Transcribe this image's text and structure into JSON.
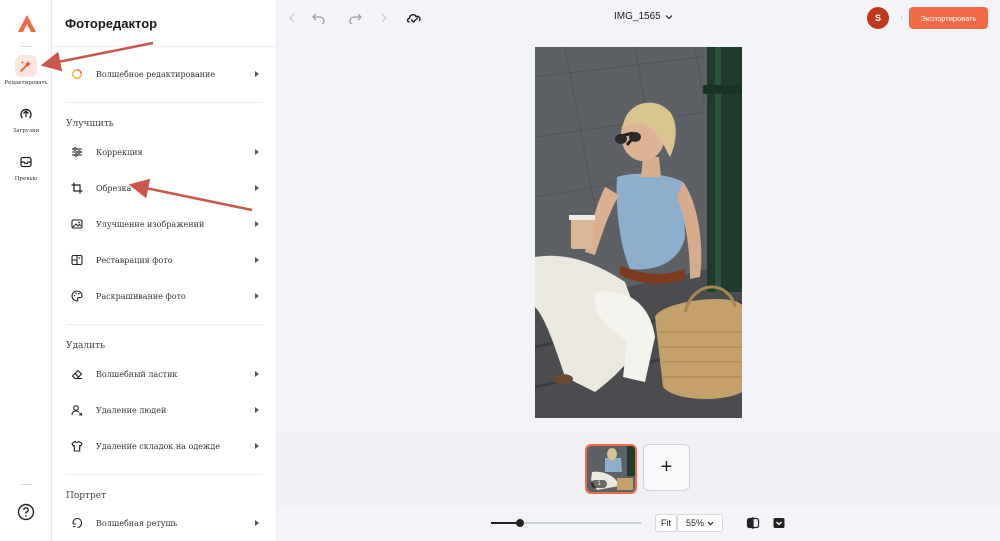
{
  "rail": {
    "items": [
      {
        "label": "Редактировать",
        "icon": "magic-edit-icon",
        "active": true
      },
      {
        "label": "Загрузки",
        "icon": "upload-icon",
        "active": false
      },
      {
        "label": "Превью",
        "icon": "inbox-icon",
        "active": false
      }
    ]
  },
  "panel": {
    "title": "Фоторедактор",
    "top_item": {
      "label": "Волшебное редактирование",
      "icon": "magic-ring-icon"
    },
    "sections": [
      {
        "heading": "Улучшить",
        "items": [
          {
            "label": "Коррекция",
            "icon": "sliders-icon"
          },
          {
            "label": "Обрезка",
            "icon": "crop-icon"
          },
          {
            "label": "Улучшение изображений",
            "icon": "image-enhance-icon"
          },
          {
            "label": "Реставрация фото",
            "icon": "restore-icon"
          },
          {
            "label": "Раскрашивание фото",
            "icon": "palette-icon"
          }
        ]
      },
      {
        "heading": "Удалить",
        "items": [
          {
            "label": "Волшебный ластик",
            "icon": "eraser-icon"
          },
          {
            "label": "Удаление людей",
            "icon": "person-remove-icon"
          },
          {
            "label": "Удаление складок на одежде",
            "icon": "shirt-icon"
          }
        ]
      },
      {
        "heading": "Портрет",
        "items": [
          {
            "label": "Волшебная ретушь",
            "icon": "face-retouch-icon"
          }
        ]
      }
    ]
  },
  "topbar": {
    "file_name": "IMG_1565",
    "avatar_initial": "S",
    "export_label": "Экспортировать"
  },
  "filmstrip": {
    "add_label": "+",
    "thumb_badge": "1"
  },
  "bottombar": {
    "fit_label": "Fit",
    "zoom_value": "55%",
    "zoom_fraction": 0.19
  },
  "colors": {
    "accent": "#f26a45",
    "avatar": "#c0391f",
    "annotation_arrow": "#c9574a"
  }
}
